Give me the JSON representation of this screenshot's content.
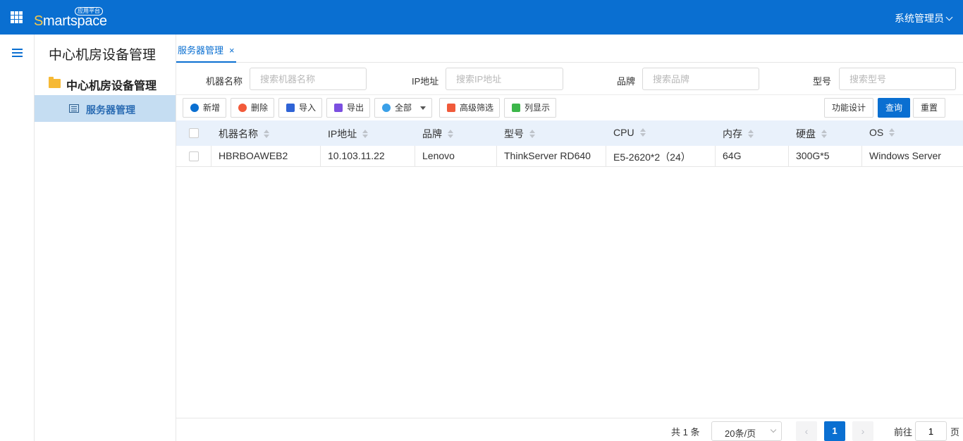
{
  "header": {
    "brand_initial": "S",
    "brand_rest": "martspace",
    "brand_badge": "应用平台",
    "user": "系统管理员"
  },
  "menu": {
    "title": "中心机房设备管理",
    "group": "中心机房设备管理",
    "item": "服务器管理"
  },
  "tabs": [
    {
      "label": "服务器管理",
      "close": "×"
    }
  ],
  "search": {
    "fields": [
      {
        "label": "机器名称",
        "placeholder": "搜索机器名称"
      },
      {
        "label": "IP地址",
        "placeholder": "搜索IP地址"
      },
      {
        "label": "品牌",
        "placeholder": "搜索品牌"
      },
      {
        "label": "型号",
        "placeholder": "搜索型号"
      }
    ]
  },
  "toolbar": {
    "add": "新增",
    "delete": "删除",
    "import": "导入",
    "export": "导出",
    "scope": "全部",
    "advanced_filter": "高级筛选",
    "columns": "列显示",
    "design": "功能设计",
    "query": "查询",
    "reset": "重置"
  },
  "table": {
    "headers": [
      "机器名称",
      "IP地址",
      "品牌",
      "型号",
      "CPU",
      "内存",
      "硬盘",
      "OS"
    ],
    "rows": [
      [
        "HBRBOAWEB2",
        "10.103.11.22",
        "Lenovo",
        "ThinkServer RD640",
        "E5-2620*2（24）",
        "64G",
        "300G*5",
        "Windows Server"
      ]
    ]
  },
  "pager": {
    "total": "共 1 条",
    "page_size": "20条/页",
    "prev": "‹",
    "current": "1",
    "next": "›",
    "goto_label": "前往",
    "goto_value": "1",
    "page_suffix": "页"
  },
  "colors": {
    "primary": "#0a6fd1",
    "selected_menu": "#c5ddf2",
    "table_header": "#e9f1fb"
  }
}
